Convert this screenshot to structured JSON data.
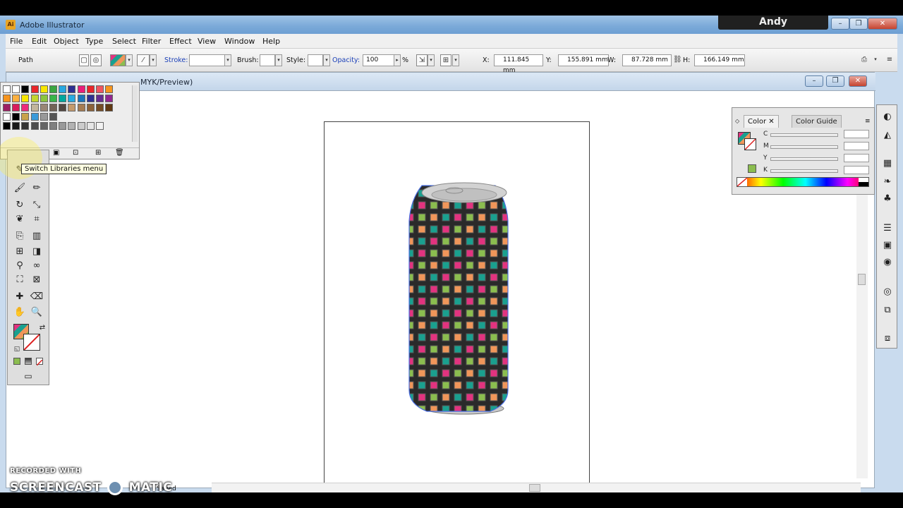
{
  "window": {
    "app_title": "Adobe Illustrator",
    "user": "Andy",
    "app_icon": "Ai"
  },
  "menu": [
    "File",
    "Edit",
    "Object",
    "Type",
    "Select",
    "Filter",
    "Effect",
    "View",
    "Window",
    "Help"
  ],
  "control": {
    "selection": "Path",
    "stroke_label": "Stroke:",
    "brush_label": "Brush:",
    "style_label": "Style:",
    "opacity_label": "Opacity:",
    "opacity_value": "100",
    "opacity_unit": "%",
    "x_label": "X:",
    "x_value": "111.845 mm",
    "y_label": "Y:",
    "y_value": "155.891 mm",
    "w_label": "W:",
    "w_value": "87.728 mm",
    "h_label": "H:",
    "h_value": "166.149 mm"
  },
  "document": {
    "title_suffix": "MYK/Preview)",
    "status": "Saved"
  },
  "tooltip": "Switch Libraries menu",
  "color_panel": {
    "tabs": [
      "Color",
      "Color Guide"
    ],
    "channels": [
      {
        "label": "C",
        "value": ""
      },
      {
        "label": "M",
        "value": ""
      },
      {
        "label": "Y",
        "value": ""
      },
      {
        "label": "K",
        "value": ""
      }
    ],
    "unit": "%"
  },
  "watermark": {
    "line1": "RECORDED WITH",
    "line2": "SCREENCAST",
    "line3": "MATIC"
  },
  "colors": {
    "pink": "#e2337f",
    "teal": "#1aa08f",
    "orange": "#f0965a",
    "lime": "#8bbd4f",
    "can_body": "#2a2a2a",
    "can_top": "#c9c9c9"
  }
}
